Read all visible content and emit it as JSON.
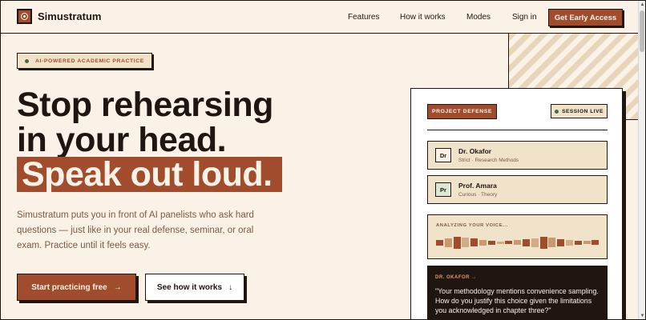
{
  "brand": {
    "name": "Simustratum"
  },
  "nav": {
    "links": [
      "Features",
      "How it works",
      "Modes",
      "Sign in"
    ],
    "cta": "Get Early Access"
  },
  "hero": {
    "badge": "AI-POWERED ACADEMIC PRACTICE",
    "headline_line1": "Stop rehearsing",
    "headline_line2": "in your head.",
    "headline_highlight": "Speak out loud.",
    "subtext": "Simustratum puts you in front of AI panelists who ask hard questions — just like in your real defense, seminar, or oral exam. Practice until it feels easy.",
    "primary_button": "Start practicing free",
    "secondary_button": "See how it works",
    "primary_arrow": "→",
    "secondary_arrow": "↓"
  },
  "session_panel": {
    "project_tag": "PROJECT DEFENSE",
    "live_tag": "SESSION LIVE",
    "panelists": [
      {
        "initials": "Dr",
        "name": "Dr. Okafor",
        "role": "Strict · Research Methods",
        "avatar_color": "#fbf2e7"
      },
      {
        "initials": "Pr",
        "name": "Prof. Amara",
        "role": "Curious · Theory",
        "avatar_color": "#dbe8d5"
      }
    ],
    "voice_label": "ANALYZING YOUR VOICE...",
    "voice_levels": [
      0.35,
      0.55,
      0.75,
      0.6,
      0.5,
      0.35,
      0.25,
      0.15,
      0.2,
      0.3,
      0.45,
      0.55,
      0.75,
      0.6,
      0.45,
      0.35,
      0.25,
      0.2,
      0.3
    ],
    "quote_speaker": "DR. OKAFOR →",
    "quote_text": "\"Your methodology mentions convenience sampling. How do you justify this choice given the limitations you acknowledged in chapter three?\""
  },
  "colors": {
    "background": "#fbf2e7",
    "accent": "#a14d2d",
    "ink": "#1f1612",
    "cream": "#f1e3c9",
    "live_green": "#4a6a3a"
  }
}
